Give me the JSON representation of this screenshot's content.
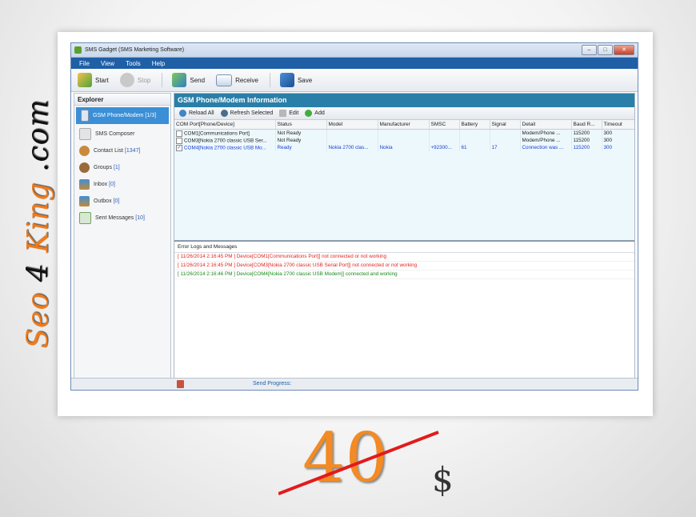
{
  "watermark": {
    "text_a": "Seo",
    "text_b": "4",
    "text_c": "King",
    "text_d": ".com"
  },
  "window": {
    "title": "SMS Gadget (SMS Marketing Software)"
  },
  "menu": [
    "File",
    "View",
    "Tools",
    "Help"
  ],
  "toolbar": {
    "start": "Start",
    "stop": "Stop",
    "send": "Send",
    "receive": "Receive",
    "save": "Save"
  },
  "explorer": {
    "header": "Explorer",
    "items": [
      {
        "label": "GSM Phone/Modem",
        "count": "[1/3]"
      },
      {
        "label": "SMS Composer",
        "count": ""
      },
      {
        "label": "Contact List",
        "count": "[1347]"
      },
      {
        "label": "Groups",
        "count": "[1]"
      },
      {
        "label": "Inbox",
        "count": "[0]"
      },
      {
        "label": "Outbox",
        "count": "[0]"
      },
      {
        "label": "Sent Messages",
        "count": "[10]"
      }
    ]
  },
  "panel": {
    "title": "GSM Phone/Modem Information",
    "reload": "Reload All",
    "refresh": "Refresh Selected",
    "edit": "Edit",
    "add": "Add"
  },
  "grid": {
    "columns": [
      "COM Port[Phone/Device]",
      "Status",
      "Model",
      "Manufacturer",
      "SMSC",
      "Battery",
      "Signal",
      "Detail",
      "Baud R...",
      "Timeout"
    ],
    "rows": [
      {
        "port": "COM1[Communications Port]",
        "status": "Not Ready",
        "model": "",
        "manufacturer": "",
        "smsc": "",
        "battery": "",
        "signal": "",
        "detail": "Modem/Phone ...",
        "baud": "115200",
        "timeout": "300",
        "checked": ""
      },
      {
        "port": "COM3[Nokia 2700 classic USB Ser...",
        "status": "Not Ready",
        "model": "",
        "manufacturer": "",
        "smsc": "",
        "battery": "",
        "signal": "",
        "detail": "Modem/Phone ...",
        "baud": "115200",
        "timeout": "300",
        "checked": ""
      },
      {
        "port": "COM4[Nokia 2700 classic USB Mo...",
        "status": "Ready",
        "model": "Nokia 2700 clas...",
        "manufacturer": "Nokia",
        "smsc": "+92300...",
        "battery": "61",
        "signal": "17",
        "detail": "Connection was ...",
        "baud": "115200",
        "timeout": "300",
        "checked": "✓"
      }
    ]
  },
  "logs": {
    "header": "Error Logs and Messages",
    "lines": [
      "[ 11/26/2014 2:16:45 PM ] Device[COM1[Communications Port]] not connected or not working",
      "[ 11/26/2014 2:16:45 PM ] Device[COM3[Nokia 2700 classic USB Serial Port]] not connected or not working",
      "[ 11/26/2014 2:16:46 PM ] Device[COM4[Nokia 2700 classic USB Modem]] connected and working"
    ]
  },
  "status": {
    "progress_label": "Send Progress:"
  },
  "price": {
    "amount": "40",
    "currency": "$"
  }
}
